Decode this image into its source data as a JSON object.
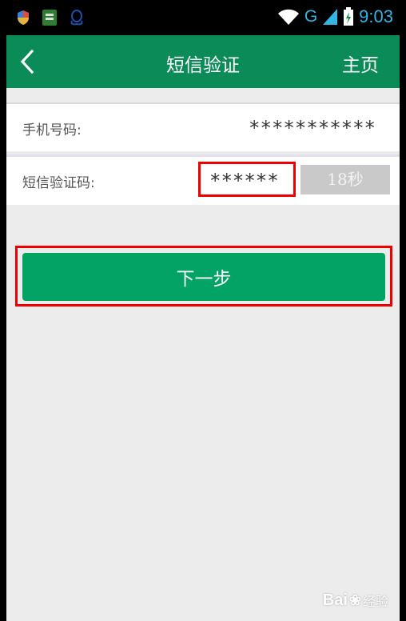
{
  "status_bar": {
    "network": "G",
    "time": "9:03",
    "icons": [
      "shield-icon",
      "sim-card-icon",
      "qq-icon",
      "wifi-icon",
      "signal-icon",
      "battery-icon"
    ]
  },
  "header": {
    "title": "短信验证",
    "back_icon": "chevron-left-icon",
    "home_label": "主页",
    "background": "#0b8b57"
  },
  "form": {
    "phone_label": "手机号码:",
    "phone_value": "***********",
    "code_label": "短信验证码:",
    "code_value": "******",
    "timer_label": "18秒"
  },
  "next_button": {
    "label": "下一步",
    "color": "#03a365"
  },
  "watermark": {
    "brand": "Bai",
    "suffix": "经验"
  },
  "highlight_color": "#e00000"
}
